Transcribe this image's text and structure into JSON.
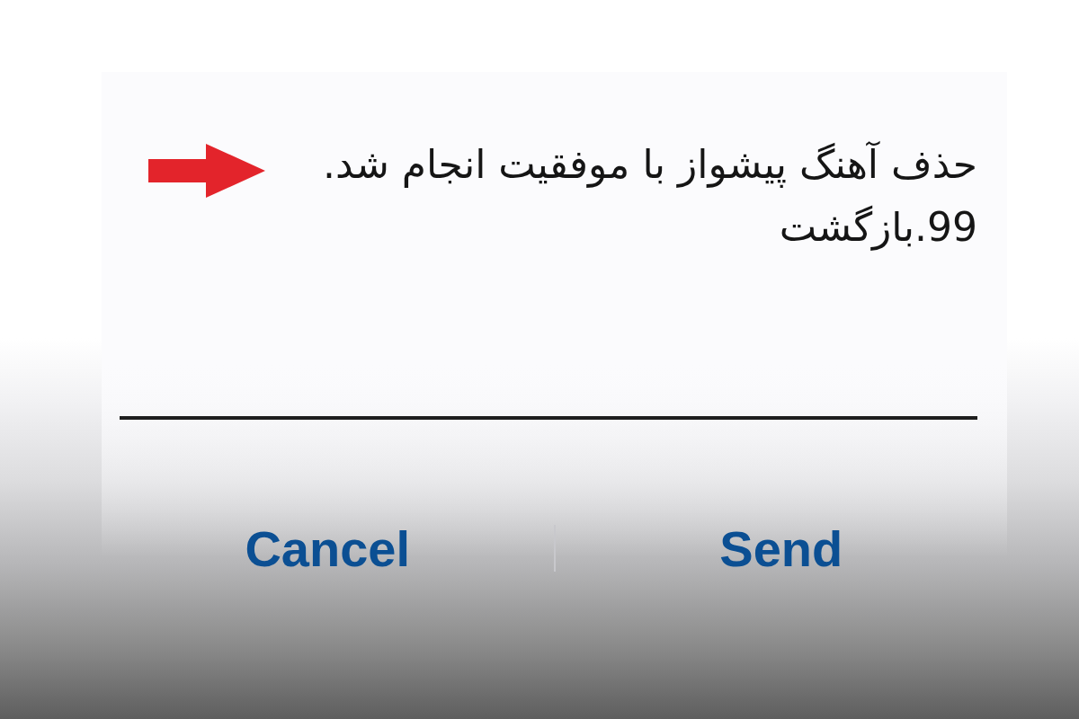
{
  "message_field": {
    "lines": [
      "حذف آهنگ پیشواز با موفقیت انجام شد.",
      "99.بازگشت"
    ]
  },
  "buttons": [
    {
      "label": "Send"
    },
    {
      "label": "Cancel"
    }
  ]
}
